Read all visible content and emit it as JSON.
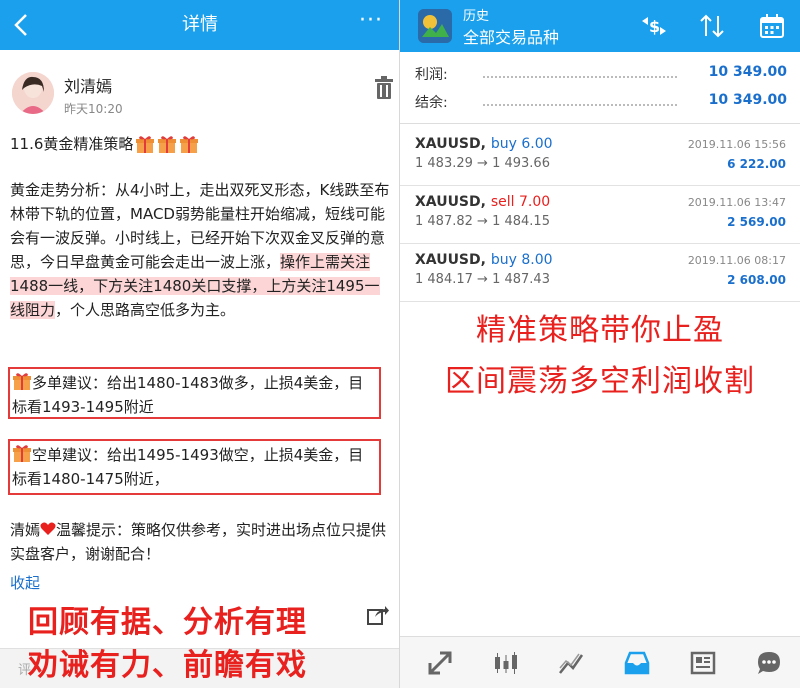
{
  "left": {
    "header": {
      "title": "详情",
      "more": "···"
    },
    "post": {
      "author": "刘清嫣",
      "time": "昨天10:20",
      "title": "11.6黄金精准策略",
      "analysis_plain": "黄金走势分析：从4小时上，走出双死叉形态，K线跌至布林带下轨的位置，MACD弱势能量柱开始缩减，短线可能会有一波反弹。小时线上，已经开始下次双金叉反弹的意思，今日早盘黄金可能会走出一波上涨，",
      "analysis_highlight": "操作上需关注1488一线，下方关注1480关口支撑，上方关注1495一线阻力",
      "analysis_tail": "，个人思路高空低多为主。",
      "long_advice": "多单建议：给出1480-1483做多，止损4美金，目标看1493-1495附近",
      "short_advice": "空单建议：给出1495-1493做空，止损4美金，目标看1480-1475附近，",
      "tip_name": "清嫣",
      "tip_text": "温馨提示：策略仅供参考，实时进出场点位只提供实盘客户，谢谢配合！",
      "collapse": "收起"
    },
    "bottom_hint": "评",
    "promo_line1": "回顾有据、分析有理",
    "promo_line2": "劝诫有力、前瞻有戏"
  },
  "right": {
    "header": {
      "title_small": "历史",
      "title_main": "全部交易品种"
    },
    "summary": [
      {
        "label": "利润:",
        "value": "10 349.00"
      },
      {
        "label": "结余:",
        "value": "10 349.00"
      }
    ],
    "trades": [
      {
        "symbol": "XAUUSD,",
        "side": "buy",
        "lots": "6.00",
        "open": "1 483.29",
        "close": "1 493.66",
        "date": "2019.11.06 15:56",
        "profit": "6 222.00"
      },
      {
        "symbol": "XAUUSD,",
        "side": "sell",
        "lots": "7.00",
        "open": "1 487.82",
        "close": "1 484.15",
        "date": "2019.11.06 13:47",
        "profit": "2 569.00"
      },
      {
        "symbol": "XAUUSD,",
        "side": "buy",
        "lots": "8.00",
        "open": "1 484.17",
        "close": "1 487.43",
        "date": "2019.11.06 08:17",
        "profit": "2 608.00"
      }
    ],
    "promo_line1": "精准策略带你止盈",
    "promo_line2": "区间震荡多空利润收割",
    "arrow": "→"
  },
  "colors": {
    "header_blue": "#1aa0ec",
    "promo_red": "#e8201e",
    "value_blue": "#1a6fcc"
  }
}
